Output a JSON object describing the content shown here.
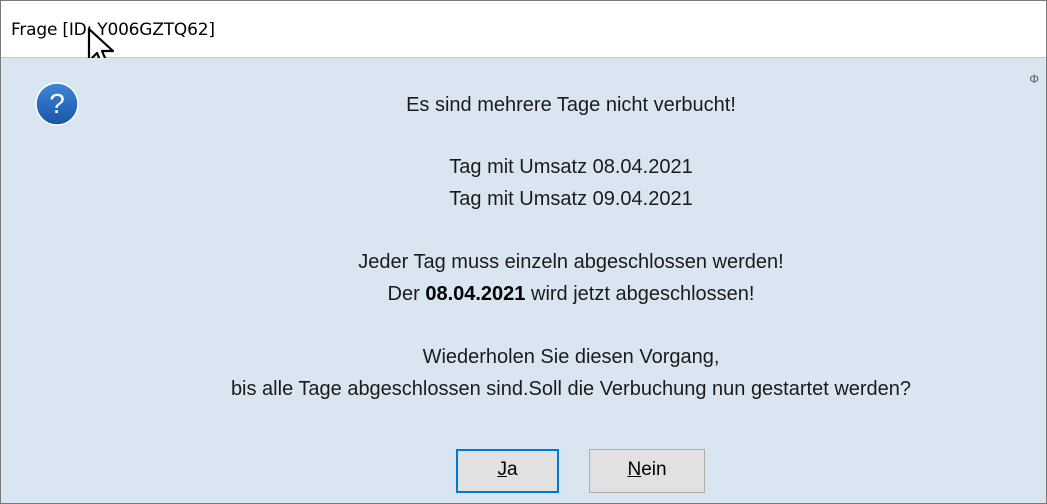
{
  "window": {
    "title": "Frage [ID: Y006GZTQ62]",
    "corner_mark": "Φ"
  },
  "icon": {
    "name": "question-icon",
    "glyph": "?",
    "color": "#1f5fb3"
  },
  "message": {
    "line1": "Es sind mehrere Tage nicht verbucht!",
    "line2": "Tag mit Umsatz 08.04.2021",
    "line3": "Tag mit Umsatz 09.04.2021",
    "line4": "Jeder Tag muss einzeln abgeschlossen werden!",
    "line5_prefix": "Der ",
    "line5_bold": "08.04.2021",
    "line5_suffix": " wird jetzt abgeschlossen!",
    "line6": "Wiederholen Sie diesen Vorgang,",
    "line7": "bis alle Tage abgeschlossen sind.Soll die Verbuchung nun gestartet werden?"
  },
  "buttons": {
    "yes_mnemonic": "J",
    "yes_rest": "a",
    "no_mnemonic": "N",
    "no_rest": "ein"
  },
  "colors": {
    "accent": "#0078d7",
    "dialog_bg": "#d9e6f2"
  }
}
